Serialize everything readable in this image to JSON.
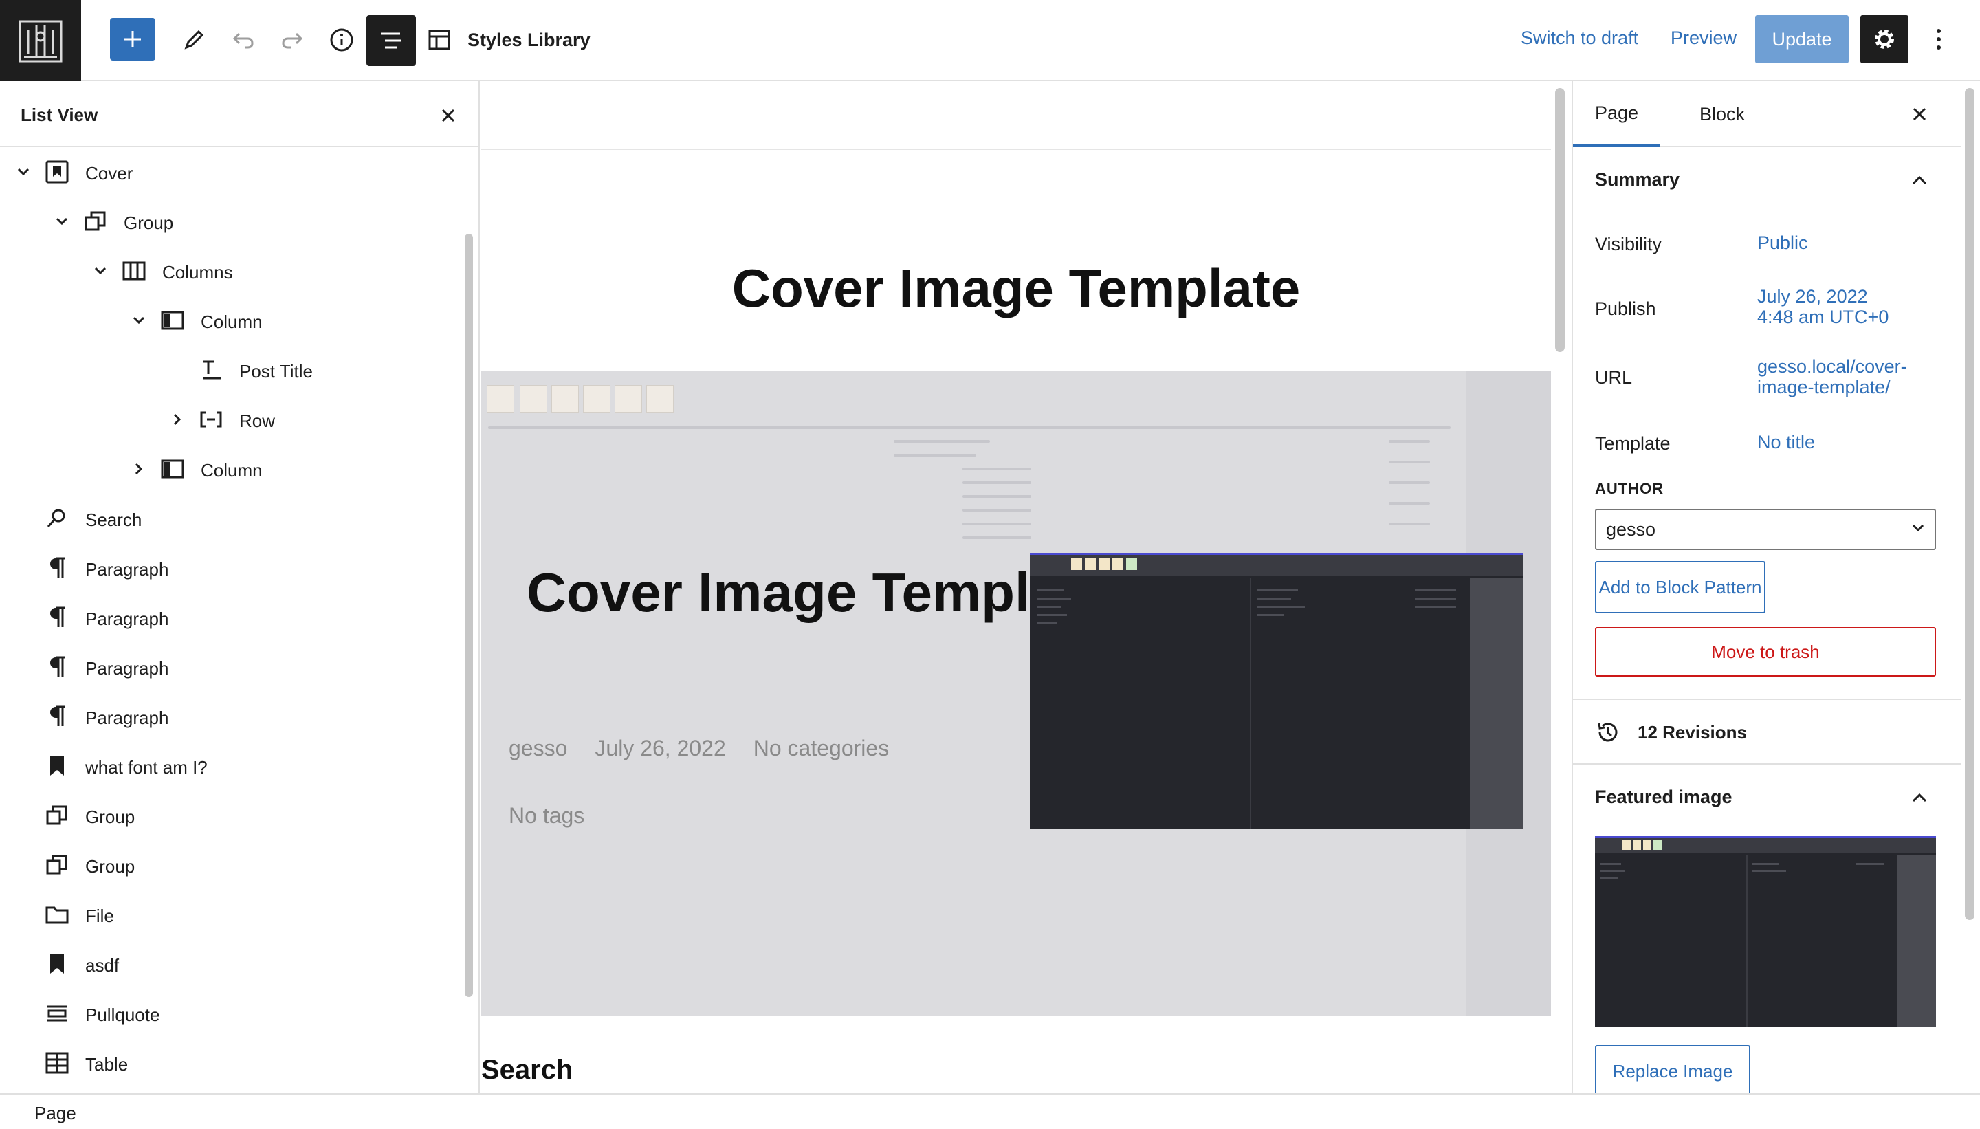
{
  "toolbar": {
    "document_title": "Styles Library",
    "switch_to_draft": "Switch to draft",
    "preview": "Preview",
    "update": "Update"
  },
  "list_view": {
    "title": "List View",
    "items": [
      {
        "label": "Cover",
        "icon": "cover-icon",
        "expanded": true,
        "depth": 0
      },
      {
        "label": "Group",
        "icon": "group-icon",
        "expanded": true,
        "depth": 1
      },
      {
        "label": "Columns",
        "icon": "columns-icon",
        "expanded": true,
        "depth": 2
      },
      {
        "label": "Column",
        "icon": "column-icon",
        "expanded": true,
        "depth": 3
      },
      {
        "label": "Post Title",
        "icon": "post-title-icon",
        "depth": 4
      },
      {
        "label": "Row",
        "icon": "row-icon",
        "expanded": false,
        "depth": 4
      },
      {
        "label": "Column",
        "icon": "column-icon",
        "expanded": false,
        "depth": 3
      },
      {
        "label": "Search",
        "icon": "search-icon",
        "depth": 0
      },
      {
        "label": "Paragraph",
        "icon": "paragraph-icon",
        "depth": 0
      },
      {
        "label": "Paragraph",
        "icon": "paragraph-icon",
        "depth": 0
      },
      {
        "label": "Paragraph",
        "icon": "paragraph-icon",
        "depth": 0
      },
      {
        "label": "Paragraph",
        "icon": "paragraph-icon",
        "depth": 0
      },
      {
        "label": "what font am I?",
        "icon": "reusable-block-icon",
        "depth": 0
      },
      {
        "label": "Group",
        "icon": "group-icon",
        "depth": 0
      },
      {
        "label": "Group",
        "icon": "group-icon",
        "depth": 0
      },
      {
        "label": "File",
        "icon": "file-icon",
        "depth": 0
      },
      {
        "label": "asdf",
        "icon": "reusable-block-icon",
        "depth": 0
      },
      {
        "label": "Pullquote",
        "icon": "pullquote-icon",
        "depth": 0
      },
      {
        "label": "Table",
        "icon": "table-icon",
        "depth": 0
      }
    ]
  },
  "canvas": {
    "page_title": "Cover Image Template",
    "cover_heading": "Cover Image Template",
    "meta": {
      "author": "gesso",
      "date": "July 26, 2022",
      "categories": "No categories"
    },
    "tags": "No tags",
    "search_heading": "Search"
  },
  "sidebar": {
    "tabs": [
      "Page",
      "Block"
    ],
    "active_tab": "Page",
    "summary_title": "Summary",
    "visibility_label": "Visibility",
    "visibility_value": "Public",
    "publish_label": "Publish",
    "publish_value_line1": "July 26, 2022",
    "publish_value_line2": "4:48 am UTC+0",
    "url_label": "URL",
    "url_value_line1": "gesso.local/cover-",
    "url_value_line2": "image-template/",
    "template_label": "Template",
    "template_value": "No title",
    "author_label": "AUTHOR",
    "author_value": "gesso",
    "add_pattern": "Add to Block Pattern",
    "move_to_trash": "Move to trash",
    "revisions": "12 Revisions",
    "featured_image_title": "Featured image",
    "replace_image": "Replace Image"
  },
  "footer": {
    "breadcrumb": "Page"
  },
  "colors": {
    "accent": "#2f6fb8",
    "danger": "#cc1818",
    "dark": "#1e1e1e",
    "update_disabled": "#6f9fd4"
  }
}
